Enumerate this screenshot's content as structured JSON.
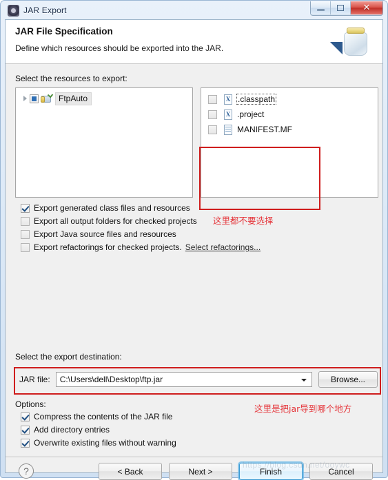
{
  "window": {
    "title": "JAR Export",
    "icon": "jar-export-icon",
    "controls": {
      "minimize": "minimize-icon",
      "maximize": "maximize-icon",
      "close": "✕"
    }
  },
  "banner": {
    "title": "JAR File Specification",
    "subtitle": "Define which resources should be exported into the JAR.",
    "art": "jar-jar-icon"
  },
  "resources": {
    "label": "Select the resources to export:",
    "tree": [
      {
        "label": "FtpAuto",
        "checkstate": "grayed",
        "expander": "collapsed",
        "icon": "java-project-icon",
        "selected": true
      }
    ],
    "files": [
      {
        "label": ".classpath",
        "checked": false,
        "icon": "xml-file-icon",
        "focused": true
      },
      {
        "label": ".project",
        "checked": false,
        "icon": "xml-file-icon",
        "focused": false
      },
      {
        "label": "MANIFEST.MF",
        "checked": false,
        "icon": "text-file-icon",
        "focused": false
      }
    ]
  },
  "export_options": [
    {
      "label": "Export generated class files and resources",
      "checked": true
    },
    {
      "label": "Export all output folders for checked projects",
      "checked": false
    },
    {
      "label": "Export Java source files and resources",
      "checked": false
    },
    {
      "label": "Export refactorings for checked projects.",
      "checked": false,
      "link": "Select refactorings..."
    }
  ],
  "destination": {
    "label": "Select the export destination:",
    "field_label": "JAR file:",
    "value": "C:\\Users\\dell\\Desktop\\ftp.jar",
    "placeholder": "",
    "browse_label": "Browse..."
  },
  "options": {
    "label": "Options:",
    "items": [
      {
        "label": "Compress the contents of the JAR file",
        "checked": true
      },
      {
        "label": "Add directory entries",
        "checked": true
      },
      {
        "label": "Overwrite existing files without warning",
        "checked": true
      }
    ]
  },
  "annotations": {
    "files_note": "这里都不要选择",
    "jar_note": "这里是把jar导到哪个地方",
    "color": "#e5373c",
    "box_color": "#cf1d1d"
  },
  "footer": {
    "help": "?",
    "back": "< Back",
    "next": "Next >",
    "finish": "Finish",
    "cancel": "Cancel"
  },
  "watermark": "https://blog.csdn.net/ooywc"
}
